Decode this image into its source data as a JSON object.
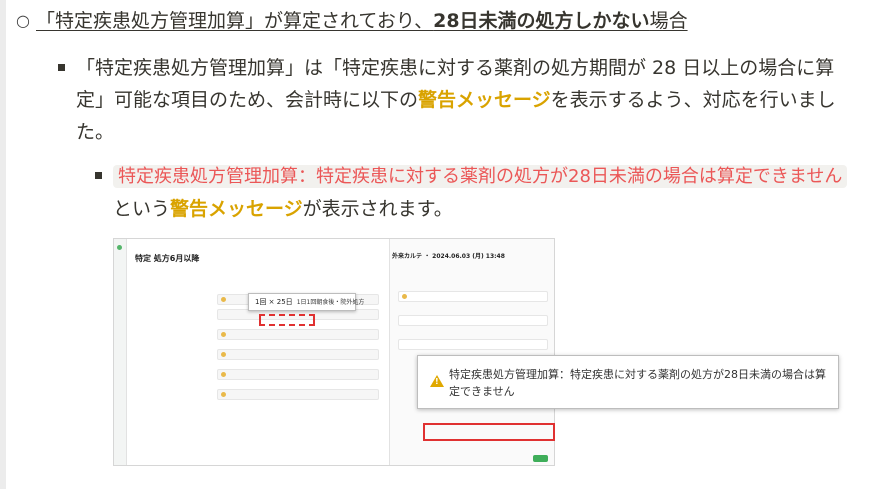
{
  "bullet1": {
    "prefix": "「特定疾患処方管理加算」が算定されており、",
    "bold": "28日未満の処方しかない",
    "suffix": "場合"
  },
  "bullet2": {
    "text1": "「特定疾患処方管理加算」は「特定疾患に対する薬剤の処方期間が 28 日以上の場合に算定」可能な項目のため、会計時に以下の",
    "highlight": "警告メッセージ",
    "text2": "を表示するよう、対応を行いました。"
  },
  "bullet3": {
    "code": "特定疾患処方管理加算：特定疾患に対する薬剤の処方が28日未満の場合は算定できません",
    "text1": "という",
    "highlight": "警告メッセージ",
    "text2": "が表示されます。"
  },
  "screenshot": {
    "left_title": "特定 処方6月以降",
    "right_title": "外来カルテ ・ 2024.06.03 (月) 13:48",
    "dose_popup_main": "1回 × 25日",
    "dose_popup_sub": "1日1回朝食後・院外処方",
    "warning_message": "特定疾患処方管理加算：特定疾患に対する薬剤の処方が28日未満の場合は算定できません"
  },
  "colors": {
    "highlight": "#d9a300",
    "code_text": "#eb5757",
    "red_box": "#e03131"
  }
}
